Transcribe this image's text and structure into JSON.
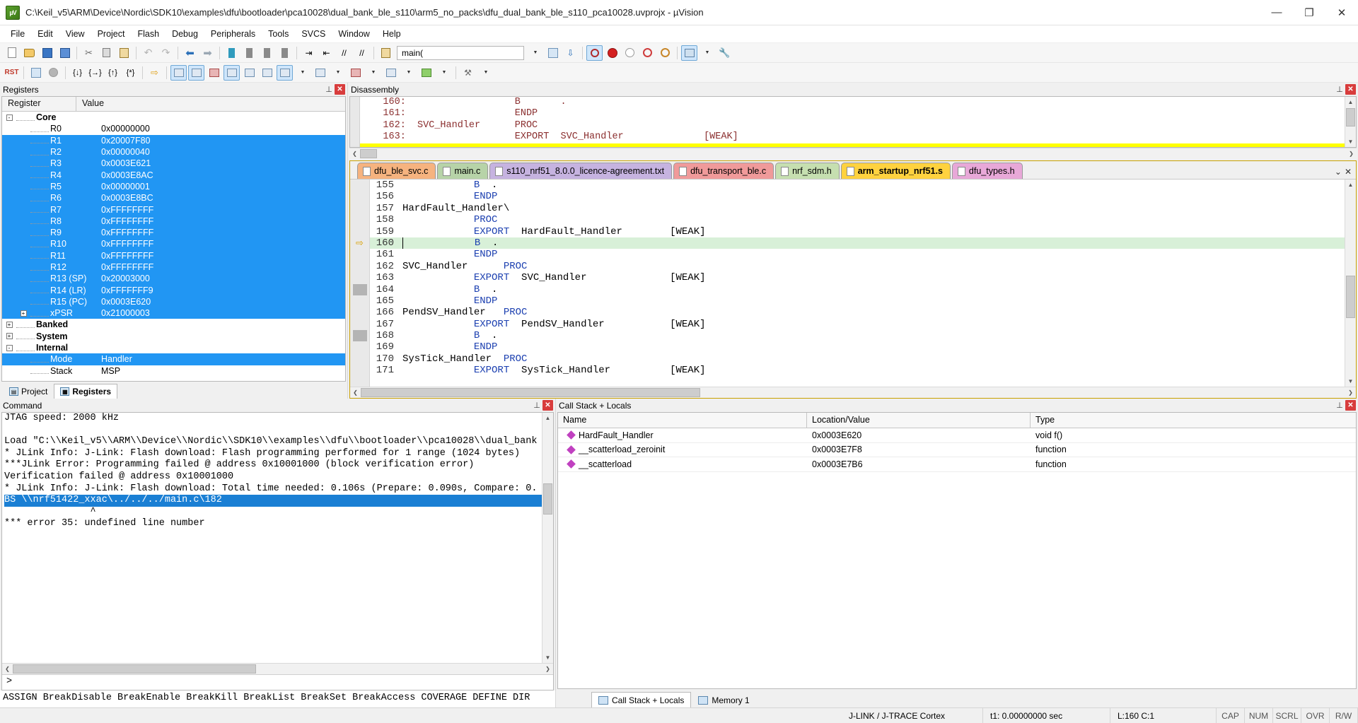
{
  "titlebar": {
    "icon": "uvision-logo-icon",
    "text": "C:\\Keil_v5\\ARM\\Device\\Nordic\\SDK10\\examples\\dfu\\bootloader\\pca10028\\dual_bank_ble_s110\\arm5_no_packs\\dfu_dual_bank_ble_s110_pca10028.uvprojx - µVision",
    "minimize": "—",
    "maximize": "❐",
    "close": "✕"
  },
  "menu": [
    "File",
    "Edit",
    "View",
    "Project",
    "Flash",
    "Debug",
    "Peripherals",
    "Tools",
    "SVCS",
    "Window",
    "Help"
  ],
  "toolbar": {
    "function_combo_value": "main(",
    "combo_arrow": "⌄"
  },
  "registers_panel": {
    "title": "Registers",
    "columns": [
      "Register",
      "Value"
    ],
    "rows": [
      {
        "name": "Core",
        "value": "",
        "level": 0,
        "expander": "-",
        "selected": false
      },
      {
        "name": "R0",
        "value": "0x00000000",
        "level": 1,
        "expander": "",
        "selected": false
      },
      {
        "name": "R1",
        "value": "0x20007F80",
        "level": 1,
        "expander": "",
        "selected": true
      },
      {
        "name": "R2",
        "value": "0x00000040",
        "level": 1,
        "expander": "",
        "selected": true
      },
      {
        "name": "R3",
        "value": "0x0003E621",
        "level": 1,
        "expander": "",
        "selected": true
      },
      {
        "name": "R4",
        "value": "0x0003E8AC",
        "level": 1,
        "expander": "",
        "selected": true
      },
      {
        "name": "R5",
        "value": "0x00000001",
        "level": 1,
        "expander": "",
        "selected": true
      },
      {
        "name": "R6",
        "value": "0x0003E8BC",
        "level": 1,
        "expander": "",
        "selected": true
      },
      {
        "name": "R7",
        "value": "0xFFFFFFFF",
        "level": 1,
        "expander": "",
        "selected": true
      },
      {
        "name": "R8",
        "value": "0xFFFFFFFF",
        "level": 1,
        "expander": "",
        "selected": true
      },
      {
        "name": "R9",
        "value": "0xFFFFFFFF",
        "level": 1,
        "expander": "",
        "selected": true
      },
      {
        "name": "R10",
        "value": "0xFFFFFFFF",
        "level": 1,
        "expander": "",
        "selected": true
      },
      {
        "name": "R11",
        "value": "0xFFFFFFFF",
        "level": 1,
        "expander": "",
        "selected": true
      },
      {
        "name": "R12",
        "value": "0xFFFFFFFF",
        "level": 1,
        "expander": "",
        "selected": true
      },
      {
        "name": "R13 (SP)",
        "value": "0x20003000",
        "level": 1,
        "expander": "",
        "selected": true
      },
      {
        "name": "R14 (LR)",
        "value": "0xFFFFFFF9",
        "level": 1,
        "expander": "",
        "selected": true
      },
      {
        "name": "R15 (PC)",
        "value": "0x0003E620",
        "level": 1,
        "expander": "",
        "selected": true
      },
      {
        "name": "xPSR",
        "value": "0x21000003",
        "level": 1,
        "expander": "+",
        "selected": true
      },
      {
        "name": "Banked",
        "value": "",
        "level": 0,
        "expander": "+",
        "selected": false
      },
      {
        "name": "System",
        "value": "",
        "level": 0,
        "expander": "+",
        "selected": false
      },
      {
        "name": "Internal",
        "value": "",
        "level": 0,
        "expander": "-",
        "selected": false
      },
      {
        "name": "Mode",
        "value": "Handler",
        "level": 1,
        "expander": "",
        "selected": true
      },
      {
        "name": "Stack",
        "value": "MSP",
        "level": 1,
        "expander": "",
        "selected": false
      }
    ],
    "bottom_tabs": [
      {
        "label": "Project",
        "active": false
      },
      {
        "label": "Registers",
        "active": true
      }
    ]
  },
  "disassembly": {
    "title": "Disassembly",
    "lines": [
      {
        "num": "160:",
        "label": "",
        "op": "B",
        "arg": "."
      },
      {
        "num": "161:",
        "label": "",
        "op": "ENDP",
        "arg": ""
      },
      {
        "num": "162:",
        "label": "SVC_Handler",
        "op": "PROC",
        "arg": ""
      },
      {
        "num": "163:",
        "label": "",
        "op": "EXPORT",
        "arg": "SVC_Handler              [WEAK]"
      }
    ]
  },
  "editor": {
    "tabs": [
      {
        "label": "dfu_ble_svc.c",
        "color": "#f6b37f",
        "active": false
      },
      {
        "label": "main.c",
        "color": "#b7d3a8",
        "active": false
      },
      {
        "label": "s110_nrf51_8.0.0_licence-agreement.txt",
        "color": "#c6b3e0",
        "active": false
      },
      {
        "label": "dfu_transport_ble.c",
        "color": "#f09a9a",
        "active": false
      },
      {
        "label": "nrf_sdm.h",
        "color": "#c6dfb0",
        "active": false
      },
      {
        "label": "arm_startup_nrf51.s",
        "color": "#ffd23f",
        "active": true
      },
      {
        "label": "dfu_types.h",
        "color": "#e8a8d8",
        "active": false
      }
    ],
    "tab_controls": {
      "dropdown": "⌄",
      "close": "✕"
    },
    "lines": [
      {
        "num": "155",
        "indent": 12,
        "code": "B",
        "arg": ".",
        "label": "",
        "current": false,
        "marker": false
      },
      {
        "num": "156",
        "indent": 12,
        "code": "ENDP",
        "arg": "",
        "label": "",
        "current": false,
        "marker": false
      },
      {
        "num": "157",
        "indent": 0,
        "code": "",
        "arg": "",
        "label": "HardFault_Handler\\",
        "current": false,
        "marker": false
      },
      {
        "num": "158",
        "indent": 12,
        "code": "PROC",
        "arg": "",
        "label": "",
        "current": false,
        "marker": false
      },
      {
        "num": "159",
        "indent": 12,
        "code": "EXPORT",
        "arg": "HardFault_Handler        [WEAK]",
        "label": "",
        "current": false,
        "marker": false
      },
      {
        "num": "160",
        "indent": 12,
        "code": "B",
        "arg": ".",
        "label": "",
        "current": true,
        "marker": false
      },
      {
        "num": "161",
        "indent": 12,
        "code": "ENDP",
        "arg": "",
        "label": "",
        "current": false,
        "marker": false
      },
      {
        "num": "162",
        "indent": 0,
        "code": "PROC",
        "arg": "",
        "label": "SVC_Handler",
        "current": false,
        "marker": false
      },
      {
        "num": "163",
        "indent": 12,
        "code": "EXPORT",
        "arg": "SVC_Handler              [WEAK]",
        "label": "",
        "current": false,
        "marker": false
      },
      {
        "num": "164",
        "indent": 12,
        "code": "B",
        "arg": ".",
        "label": "",
        "current": false,
        "marker": true
      },
      {
        "num": "165",
        "indent": 12,
        "code": "ENDP",
        "arg": "",
        "label": "",
        "current": false,
        "marker": false
      },
      {
        "num": "166",
        "indent": 0,
        "code": "PROC",
        "arg": "",
        "label": "PendSV_Handler",
        "current": false,
        "marker": false
      },
      {
        "num": "167",
        "indent": 12,
        "code": "EXPORT",
        "arg": "PendSV_Handler           [WEAK]",
        "label": "",
        "current": false,
        "marker": false
      },
      {
        "num": "168",
        "indent": 12,
        "code": "B",
        "arg": ".",
        "label": "",
        "current": false,
        "marker": true
      },
      {
        "num": "169",
        "indent": 12,
        "code": "ENDP",
        "arg": "",
        "label": "",
        "current": false,
        "marker": false
      },
      {
        "num": "170",
        "indent": 0,
        "code": "PROC",
        "arg": "",
        "label": "SysTick_Handler",
        "current": false,
        "marker": false
      },
      {
        "num": "171",
        "indent": 12,
        "code": "EXPORT",
        "arg": "SysTick_Handler          [WEAK]",
        "label": "",
        "current": false,
        "marker": false
      }
    ]
  },
  "command_panel": {
    "title": "Command",
    "lines": [
      {
        "text": "JTAG speed: 2000 kHz",
        "selected": false
      },
      {
        "text": "",
        "selected": false
      },
      {
        "text": "Load \"C:\\\\Keil_v5\\\\ARM\\\\Device\\\\Nordic\\\\SDK10\\\\examples\\\\dfu\\\\bootloader\\\\pca10028\\\\dual_bank",
        "selected": false
      },
      {
        "text": "* JLink Info: J-Link: Flash download: Flash programming performed for 1 range (1024 bytes)",
        "selected": false
      },
      {
        "text": "***JLink Error: Programming failed @ address 0x10001000 (block verification error)",
        "selected": false
      },
      {
        "text": "Verification failed @ address 0x10001000",
        "selected": false
      },
      {
        "text": "* JLink Info: J-Link: Flash download: Total time needed: 0.106s (Prepare: 0.090s, Compare: 0.",
        "selected": false
      },
      {
        "text": "BS \\\\nrf51422_xxac\\../../../main.c\\182",
        "selected": true
      },
      {
        "text": "               ^",
        "selected": false
      },
      {
        "text": "*** error 35: undefined line number",
        "selected": false
      }
    ],
    "prompt": ">",
    "footer": "ASSIGN BreakDisable BreakEnable BreakKill BreakList BreakSet BreakAccess COVERAGE DEFINE DIR"
  },
  "callstack_panel": {
    "title": "Call Stack + Locals",
    "columns": [
      "Name",
      "Location/Value",
      "Type"
    ],
    "rows": [
      {
        "name": "HardFault_Handler",
        "location": "0x0003E620",
        "type": "void f()"
      },
      {
        "name": "__scatterload_zeroinit",
        "location": "0x0003E7F8",
        "type": "function"
      },
      {
        "name": "__scatterload",
        "location": "0x0003E7B6",
        "type": "function"
      }
    ],
    "tabs": [
      {
        "label": "Call Stack + Locals",
        "active": true
      },
      {
        "label": "Memory 1",
        "active": false
      }
    ]
  },
  "statusbar": {
    "debugger": "J-LINK / J-TRACE Cortex",
    "time": "t1: 0.00000000 sec",
    "position": "L:160 C:1",
    "cap": "CAP",
    "num": "NUM",
    "scrl": "SCRL",
    "ovr": "OVR",
    "rw": "R/W"
  }
}
